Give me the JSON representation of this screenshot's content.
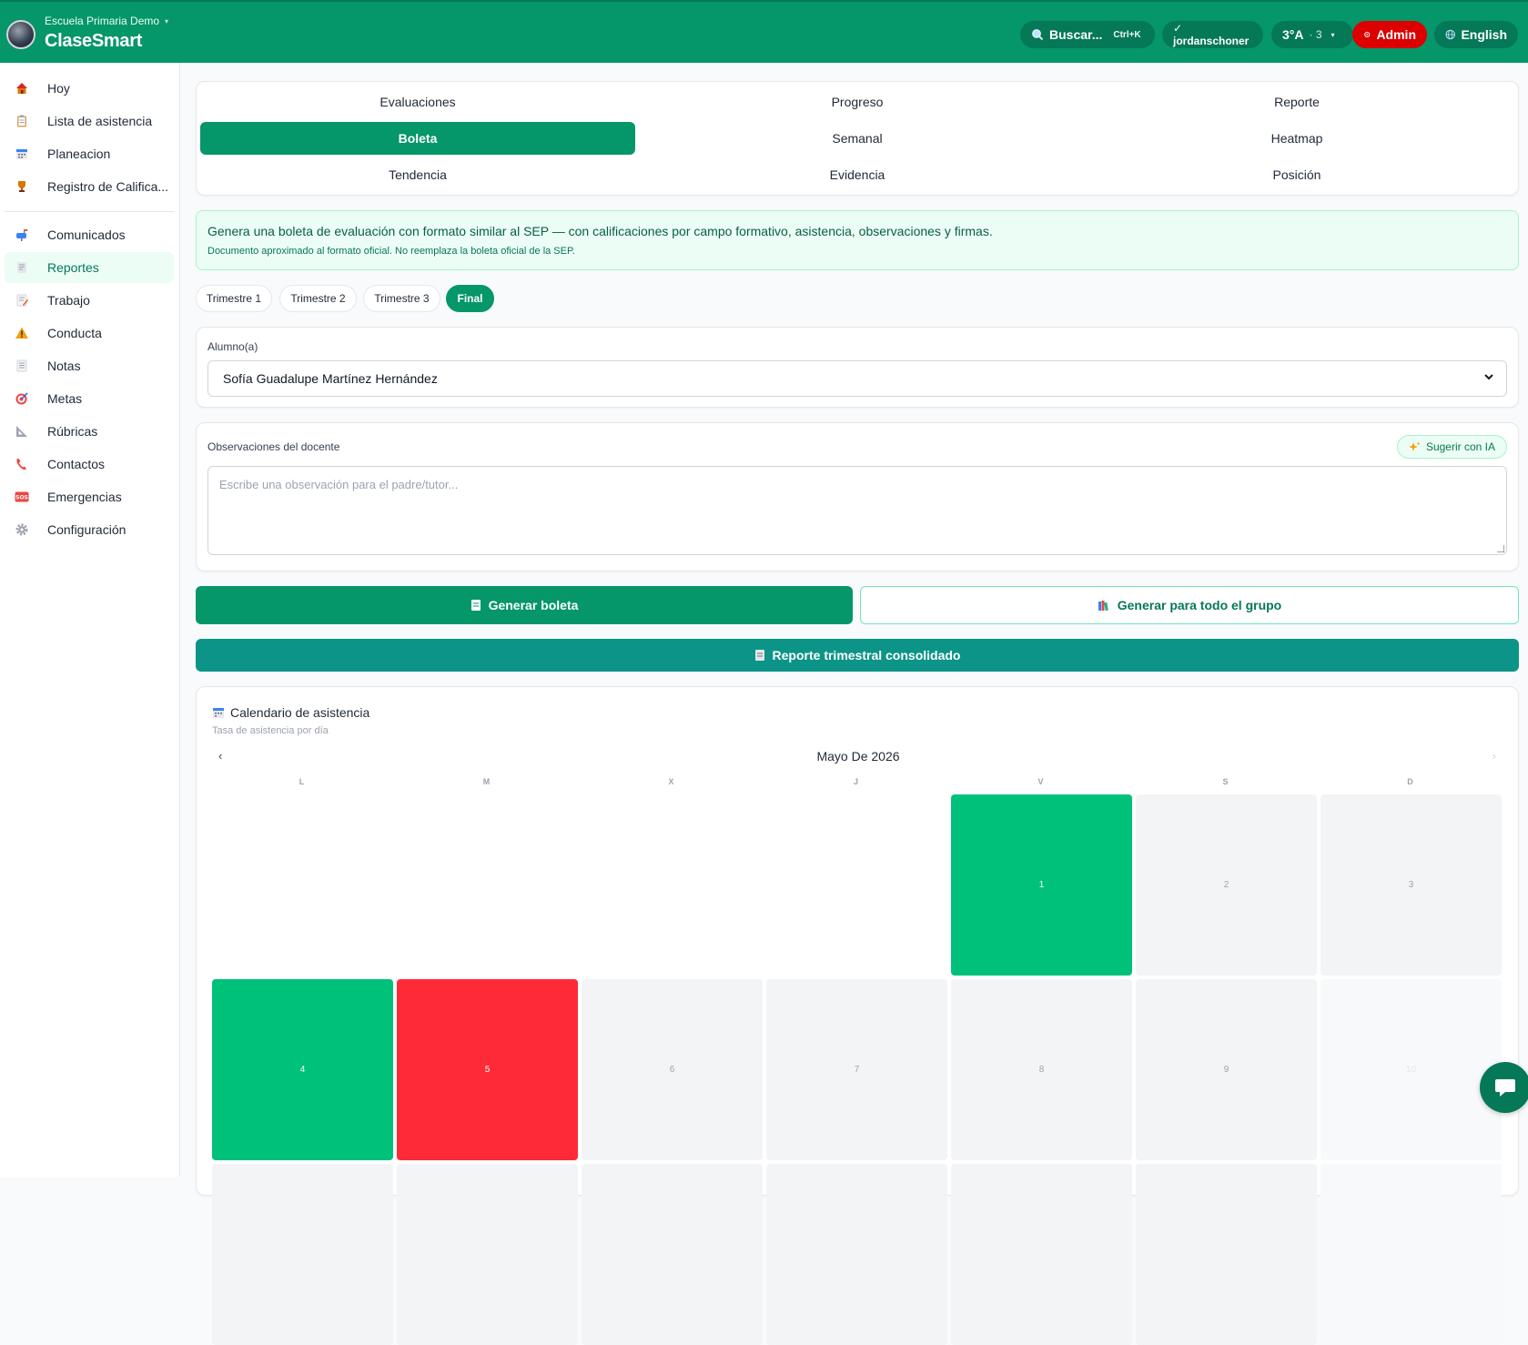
{
  "header": {
    "school": "Escuela Primaria Demo",
    "app_name": "ClaseSmart",
    "search_label": "Buscar...",
    "search_shortcut": "Ctrl+K",
    "user_label": "✓ jordanschoner",
    "group_label": "3°A",
    "group_count": "· 3",
    "admin_label": "Admin",
    "lang_label": "English"
  },
  "sidebar": {
    "items": [
      {
        "label": "Hoy",
        "icon": "house-icon"
      },
      {
        "label": "Lista de asistencia",
        "icon": "clipboard-icon"
      },
      {
        "label": "Planeacion",
        "icon": "calendar-icon"
      },
      {
        "label": "Registro de Califica...",
        "icon": "trophy-icon"
      },
      {
        "label": "Comunicados",
        "icon": "mailbox-icon"
      },
      {
        "label": "Reportes",
        "icon": "report-icon",
        "active": true
      },
      {
        "label": "Trabajo",
        "icon": "memo-icon"
      },
      {
        "label": "Conducta",
        "icon": "warning-icon"
      },
      {
        "label": "Notas",
        "icon": "note-icon"
      },
      {
        "label": "Metas",
        "icon": "target-icon"
      },
      {
        "label": "Rúbricas",
        "icon": "ruler-icon"
      },
      {
        "label": "Contactos",
        "icon": "phone-icon"
      },
      {
        "label": "Emergencias",
        "icon": "sos-icon"
      },
      {
        "label": "Configuración",
        "icon": "gear-icon"
      }
    ]
  },
  "tabs": [
    {
      "label": "Evaluaciones"
    },
    {
      "label": "Progreso"
    },
    {
      "label": "Reporte"
    },
    {
      "label": "Boleta",
      "active": true
    },
    {
      "label": "Semanal"
    },
    {
      "label": "Heatmap"
    },
    {
      "label": "Tendencia"
    },
    {
      "label": "Evidencia"
    },
    {
      "label": "Posición"
    }
  ],
  "info": {
    "line1": "Genera una boleta de evaluación con formato similar al SEP — con calificaciones por campo formativo, asistencia, observaciones y firmas.",
    "line2": "Documento aproximado al formato oficial. No reemplaza la boleta oficial de la SEP."
  },
  "periods": [
    {
      "label": "Trimestre 1"
    },
    {
      "label": "Trimestre 2"
    },
    {
      "label": "Trimestre 3"
    },
    {
      "label": "Final",
      "active": true
    }
  ],
  "student": {
    "label": "Alumno(a)",
    "selected": "Sofía Guadalupe Martínez Hernández"
  },
  "observations": {
    "label": "Observaciones del docente",
    "ai_button": "Sugerir con IA",
    "placeholder": "Escribe una observación para el padre/tutor..."
  },
  "actions": {
    "generate": "Generar boleta",
    "generate_group": "Generar para todo el grupo",
    "quarterly": "Reporte trimestral consolidado"
  },
  "calendar": {
    "title": "Calendario de asistencia",
    "subtitle": "Tasa de asistencia por día",
    "month": "Mayo De 2026",
    "prev": "‹",
    "next": "›",
    "weekdays": [
      "L",
      "M",
      "X",
      "J",
      "V",
      "S",
      "D"
    ],
    "colors": {
      "present": "#00c17a",
      "absent": "#ff2a38",
      "empty": "#f3f4f6"
    },
    "days": [
      {
        "day": "1",
        "status": "present"
      },
      {
        "day": "2",
        "status": "none"
      },
      {
        "day": "3",
        "status": "none"
      },
      {
        "day": "4",
        "status": "present"
      },
      {
        "day": "5",
        "status": "absent"
      },
      {
        "day": "6",
        "status": "none"
      },
      {
        "day": "7",
        "status": "none"
      },
      {
        "day": "8",
        "status": "none"
      },
      {
        "day": "9",
        "status": "none"
      },
      {
        "day": "10",
        "status": "future"
      }
    ]
  }
}
